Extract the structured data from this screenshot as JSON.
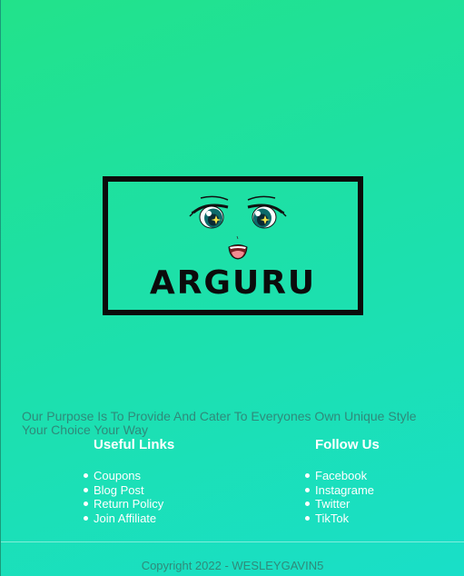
{
  "brand": {
    "logo_text": "ARGURU"
  },
  "footer": {
    "purpose": "Our Purpose Is To Provide And Cater To Everyones Own Unique Style Your Choice Your Way",
    "useful_links": {
      "heading": "Useful Links",
      "items": [
        "Coupons",
        "Blog Post",
        "Return Policy",
        "Join Affiliate"
      ]
    },
    "follow_us": {
      "heading": "Follow Us",
      "items": [
        "Facebook",
        "Instagrame",
        "Twitter",
        "TikTok"
      ]
    },
    "copyright": "Copyright 2022 - WESLEYGAVIN5"
  },
  "colors": {
    "gradient_start": "#22e28a",
    "gradient_end": "#19dfc8",
    "logo_ink": "#0b0b0b",
    "muted_text": "#2f8a7a",
    "link_text": "#ffffff"
  },
  "icons": [
    "anime-face-icon"
  ]
}
